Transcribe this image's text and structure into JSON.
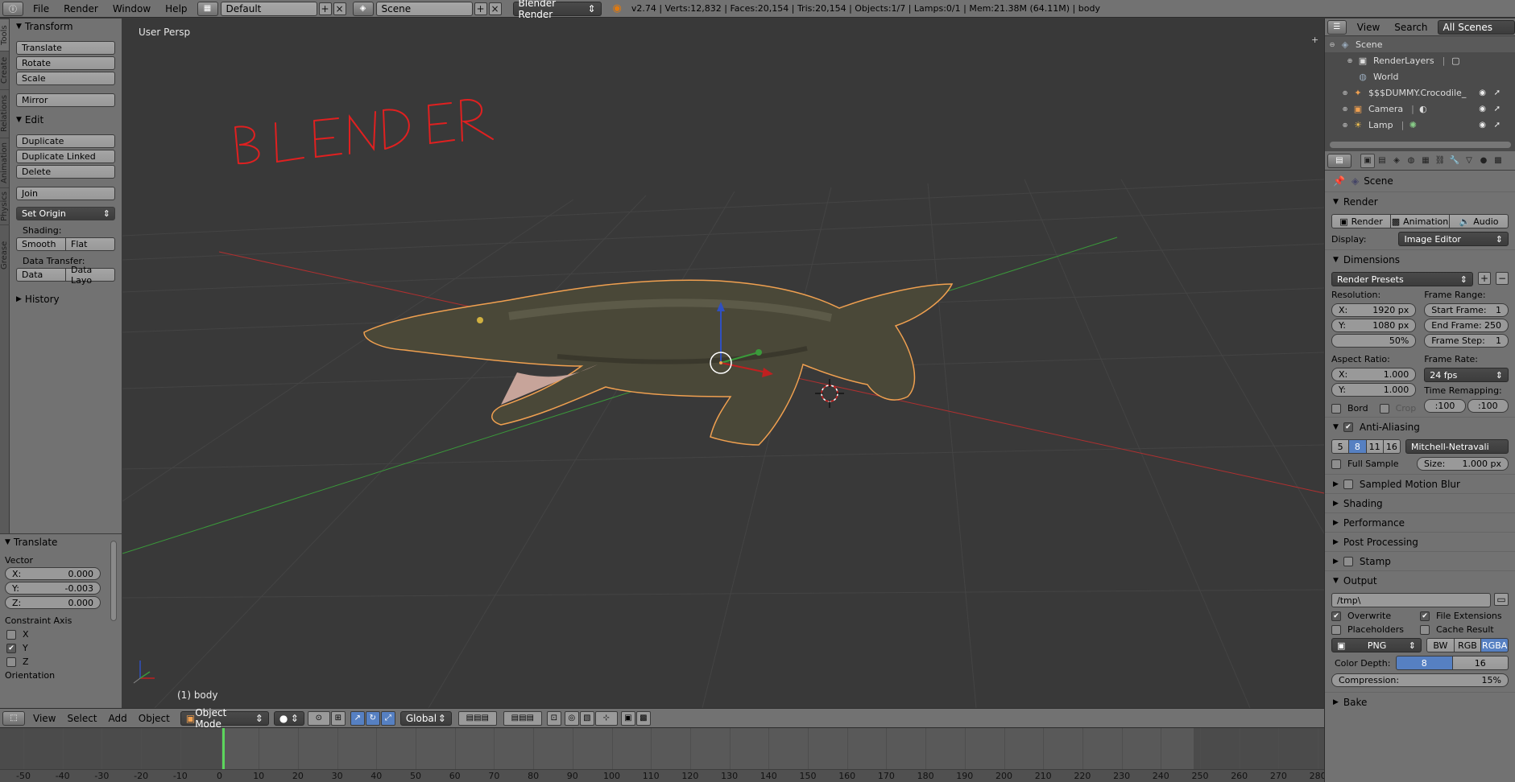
{
  "topbar": {
    "menus": [
      "File",
      "Render",
      "Window",
      "Help"
    ],
    "layout": "Default",
    "scene": "Scene",
    "engine": "Blender Render",
    "stats": "v2.74 | Verts:12,832 | Faces:20,154 | Tris:20,154 | Objects:1/7 | Lamps:0/1 | Mem:21.38M (64.11M) | body"
  },
  "vtabs": [
    "Tools",
    "Create",
    "Relations",
    "Animation",
    "Physics",
    "Grease Pencil"
  ],
  "toolshelf": {
    "transform_title": "Transform",
    "translate": "Translate",
    "rotate": "Rotate",
    "scale": "Scale",
    "mirror": "Mirror",
    "edit_title": "Edit",
    "duplicate": "Duplicate",
    "duplicate_linked": "Duplicate Linked",
    "delete": "Delete",
    "join": "Join",
    "set_origin": "Set Origin",
    "shading_label": "Shading:",
    "smooth": "Smooth",
    "flat": "Flat",
    "data_transfer_label": "Data Transfer:",
    "data": "Data",
    "data_layout": "Data Layo",
    "history_title": "History"
  },
  "operator": {
    "title": "Translate",
    "vector_label": "Vector",
    "x_label": "X:",
    "x": "0.000",
    "y_label": "Y:",
    "y": "-0.003",
    "z_label": "Z:",
    "z": "0.000",
    "constraint_label": "Constraint Axis",
    "cx": "X",
    "cy": "Y",
    "cz": "Z",
    "orientation_label": "Orientation"
  },
  "viewport": {
    "view_name": "User Persp",
    "object_name": "(1) body",
    "annotation": "BLENDER"
  },
  "view_header": {
    "menus": [
      "View",
      "Select",
      "Add",
      "Object"
    ],
    "mode": "Object Mode",
    "orientation": "Global"
  },
  "timeline": {
    "ticks": [
      "-50",
      "-40",
      "-30",
      "-20",
      "-10",
      "0",
      "10",
      "20",
      "30",
      "40",
      "50",
      "60",
      "70",
      "80",
      "90",
      "100",
      "110",
      "120",
      "130",
      "140",
      "150",
      "160",
      "170",
      "180",
      "190",
      "200",
      "210",
      "220",
      "230",
      "240",
      "250",
      "260",
      "270",
      "280"
    ],
    "current_frame": 1
  },
  "outliner": {
    "view": "View",
    "search": "Search",
    "filter": "All Scenes",
    "items": [
      {
        "label": "Scene",
        "icon": "scene-icon"
      },
      {
        "label": "RenderLayers",
        "icon": "renderlayers-icon"
      },
      {
        "label": "World",
        "icon": "world-icon"
      },
      {
        "label": "$$$DUMMY.Crocodile_",
        "icon": "armature-icon"
      },
      {
        "label": "Camera",
        "icon": "camera-icon"
      },
      {
        "label": "Lamp",
        "icon": "lamp-icon"
      }
    ]
  },
  "properties": {
    "context": "Scene",
    "render_title": "Render",
    "render_btn": "Render",
    "animation_btn": "Animation",
    "audio_btn": "Audio",
    "display_label": "Display:",
    "display_value": "Image Editor",
    "dimensions_title": "Dimensions",
    "render_presets": "Render Presets",
    "resolution_label": "Resolution:",
    "res_x_label": "X:",
    "res_x": "1920 px",
    "res_y_label": "Y:",
    "res_y": "1080 px",
    "res_pct": "50%",
    "frame_range_label": "Frame Range:",
    "start_label": "Start Frame:",
    "start": "1",
    "end_label": "End Frame:",
    "end": "250",
    "step_label": "Frame Step:",
    "step": "1",
    "aspect_label": "Aspect Ratio:",
    "asp_x_label": "X:",
    "asp_x": "1.000",
    "asp_y_label": "Y:",
    "asp_y": "1.000",
    "frame_rate_label": "Frame Rate:",
    "frame_rate": "24 fps",
    "time_remap_label": "Time Remapping:",
    "remap_old": ":100",
    "remap_new": ":100",
    "bord": "Bord",
    "crop": "Crop",
    "aa_title": "Anti-Aliasing",
    "aa_samples": [
      "5",
      "8",
      "11",
      "16"
    ],
    "aa_active": "8",
    "aa_filter": "Mitchell-Netravali",
    "full_sample": "Full Sample",
    "size_label": "Size:",
    "size": "1.000 px",
    "sampled_motion_blur": "Sampled Motion Blur",
    "shading": "Shading",
    "performance": "Performance",
    "post_processing": "Post Processing",
    "stamp": "Stamp",
    "output_title": "Output",
    "output_path": "/tmp\\",
    "overwrite": "Overwrite",
    "file_extensions": "File Extensions",
    "placeholders": "Placeholders",
    "cache_result": "Cache Result",
    "format": "PNG",
    "bw": "BW",
    "rgb": "RGB",
    "rgba": "RGBA",
    "color_depth_label": "Color Depth:",
    "depth_8": "8",
    "depth_16": "16",
    "compression_label": "Compression:",
    "compression": "15%",
    "bake": "Bake"
  },
  "colors": {
    "accent_blue": "#5680c2",
    "axis_x": "#b03030",
    "axis_y": "#3a9a3a",
    "selection_outline": "#f0a050",
    "annotation_red": "#e02020"
  }
}
